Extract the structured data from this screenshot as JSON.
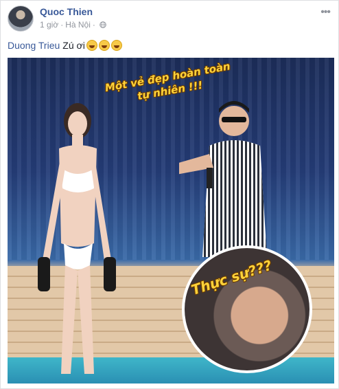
{
  "post": {
    "author_name": "Quoc Thien",
    "time": "1 giờ",
    "separator": "·",
    "location": "Hà Nội",
    "more_label": "•••",
    "mention": "Duong Trieu",
    "text": "Zú ơi",
    "emojis": [
      "grinning-sweat-emoji",
      "grinning-sweat-emoji",
      "grinning-sweat-emoji"
    ]
  },
  "photo": {
    "caption_top_line1": "Một vẻ đẹp hoàn toàn",
    "caption_top_line2": "tự nhiên !!!",
    "caption_inset": "Thực sự???"
  },
  "colors": {
    "link": "#385898",
    "meta": "#90949c",
    "caption": "#ffd23a"
  }
}
